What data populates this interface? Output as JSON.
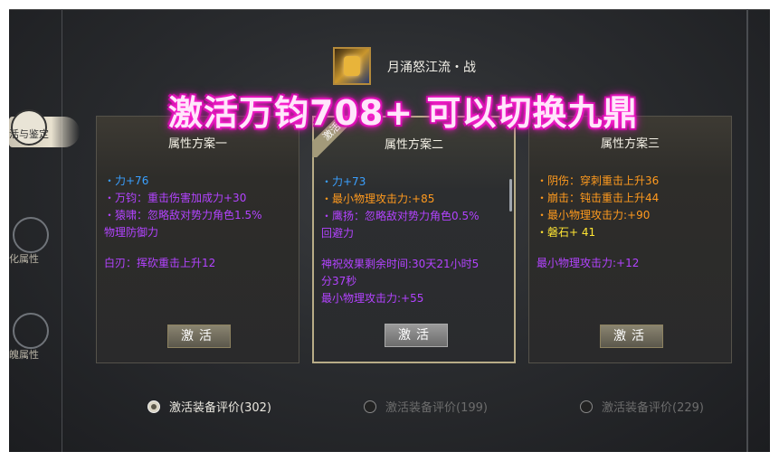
{
  "sidebar": {
    "items": [
      {
        "label": "活与鉴定",
        "icon": "compass-icon"
      },
      {
        "label": "化属性",
        "icon": "moon-icon"
      },
      {
        "label": "魄属性",
        "icon": "crescent-eye-icon"
      }
    ]
  },
  "header": {
    "title": "月涌怒江流・战",
    "icon": "weapon-emblem-icon",
    "overlay": "激活万钧708+ 可以切换九鼎"
  },
  "panels": [
    {
      "title": "属性方案一",
      "lines": [
        {
          "text": "・力+76",
          "color": "blue"
        },
        {
          "text": "・万钧：重击伤害加成力+30",
          "color": "purple"
        },
        {
          "text": "・猿啸：忽略敌对势力角色1.5%",
          "color": "purple"
        },
        {
          "text": "物理防御力",
          "color": "purple"
        },
        {
          "text": "白刃：挥砍重击上升12",
          "color": "purple"
        }
      ],
      "button": "激活"
    },
    {
      "title": "属性方案二",
      "badge": "激活",
      "lines": [
        {
          "text": "・力+73",
          "color": "blue"
        },
        {
          "text": "・最小物理攻击力:+85",
          "color": "orange"
        },
        {
          "text": "・鹰扬：忽略敌对势力角色0.5%",
          "color": "purple"
        },
        {
          "text": "回避力",
          "color": "purple"
        },
        {
          "text": "神祝效果剩余时间:30天21小时5",
          "color": "purple"
        },
        {
          "text": "分37秒",
          "color": "purple"
        },
        {
          "text": "最小物理攻击力:+55",
          "color": "purple"
        }
      ],
      "button": "激活"
    },
    {
      "title": "属性方案三",
      "lines": [
        {
          "text": "・阴伤：穿刺重击上升36",
          "color": "orange"
        },
        {
          "text": "・崩击：钝击重击上升44",
          "color": "orange"
        },
        {
          "text": "・最小物理攻击力:+90",
          "color": "orange"
        },
        {
          "text": "・磐石+ 41",
          "color": "yellow"
        },
        {
          "text": "最小物理攻击力:+12",
          "color": "purple"
        }
      ],
      "button": "激活"
    }
  ],
  "radios": [
    {
      "label": "激活装备评价(302)",
      "selected": true
    },
    {
      "label": "激活装备评价(199)",
      "selected": false
    },
    {
      "label": "激活装备评价(229)",
      "selected": false
    }
  ],
  "colors": {
    "blue": "#3aa0ff",
    "purple": "#b343ff",
    "orange": "#ff9a1e",
    "yellow": "#ffe533",
    "overlay_glow": "#ff2ad4"
  }
}
